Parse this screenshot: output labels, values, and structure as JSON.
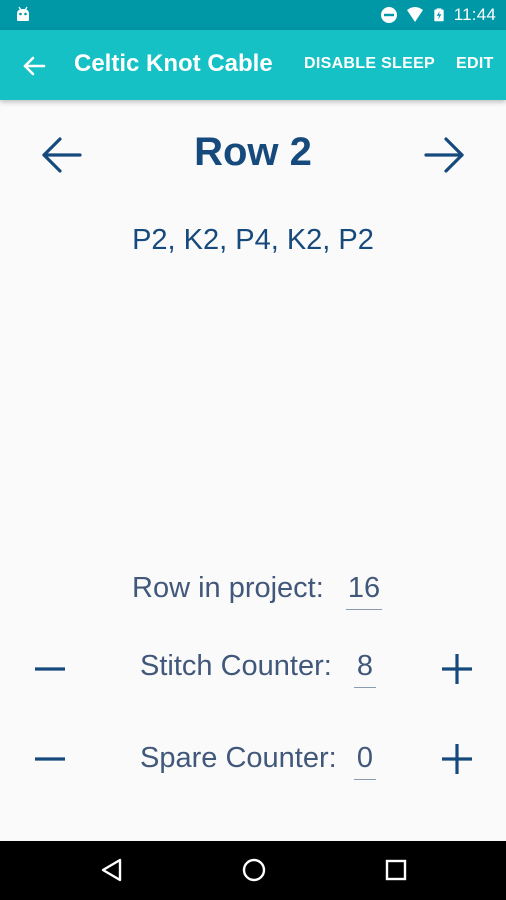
{
  "status_bar": {
    "time": "11:44",
    "icons": [
      "android-debug-icon",
      "do-not-disturb-icon",
      "wifi-icon",
      "battery-charging-icon"
    ]
  },
  "app_bar": {
    "title": "Celtic Knot Cable",
    "actions": {
      "disable_sleep": "DISABLE SLEEP",
      "edit": "EDIT"
    },
    "colors": {
      "app_bar": "#16c1c6",
      "status_bar": "#0097a7"
    }
  },
  "row_nav": {
    "title": "Row 2",
    "instructions": "P2, K2, P4, K2, P2",
    "text_color": "#174a7c"
  },
  "counters": {
    "row_in_project": {
      "label": "Row in project:",
      "value": "16"
    },
    "stitch_counter": {
      "label": "Stitch Counter:",
      "value": "8"
    },
    "spare_counter": {
      "label": "Spare Counter:",
      "value": "0"
    }
  },
  "system_nav": {
    "buttons": [
      "back-triangle-icon",
      "home-circle-icon",
      "recents-square-icon"
    ]
  }
}
